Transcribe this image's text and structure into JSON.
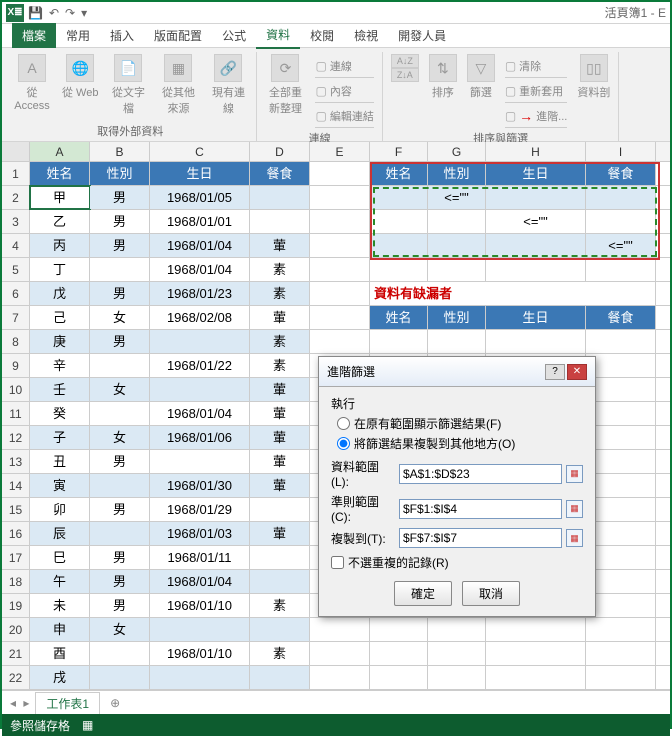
{
  "window": {
    "title": "活頁簿1 - E"
  },
  "tabs": {
    "file": "檔案",
    "home": "常用",
    "insert": "插入",
    "layout": "版面配置",
    "formula": "公式",
    "data": "資料",
    "review": "校閱",
    "view": "檢視",
    "dev": "開發人員"
  },
  "ribbon": {
    "g1": {
      "label": "取得外部資料",
      "b1": "從 Access",
      "b2": "從 Web",
      "b3": "從文字檔",
      "b4": "從其他來源",
      "b5": "現有連線"
    },
    "g2": {
      "label": "連線",
      "b1": "全部重新整理",
      "i1": "連線",
      "i2": "內容",
      "i3": "編輯連結"
    },
    "g3": {
      "label": "排序與篩選",
      "b1": "排序",
      "b2": "篩選",
      "i1": "清除",
      "i2": "重新套用",
      "i3": "進階...",
      "b3": "資料剖"
    }
  },
  "cols": [
    "A",
    "B",
    "C",
    "D",
    "E",
    "F",
    "G",
    "H",
    "I"
  ],
  "headers": {
    "c1": "姓名",
    "c2": "性別",
    "c3": "生日",
    "c4": "餐食"
  },
  "rows": [
    {
      "n": "甲",
      "s": "男",
      "d": "1968/01/05",
      "f": ""
    },
    {
      "n": "乙",
      "s": "男",
      "d": "1968/01/01",
      "f": ""
    },
    {
      "n": "丙",
      "s": "男",
      "d": "1968/01/04",
      "f": "葷"
    },
    {
      "n": "丁",
      "s": "",
      "d": "1968/01/04",
      "f": "素"
    },
    {
      "n": "戊",
      "s": "男",
      "d": "1968/01/23",
      "f": "素"
    },
    {
      "n": "己",
      "s": "女",
      "d": "1968/02/08",
      "f": "葷"
    },
    {
      "n": "庚",
      "s": "男",
      "d": "",
      "f": "素"
    },
    {
      "n": "辛",
      "s": "",
      "d": "1968/01/22",
      "f": "素"
    },
    {
      "n": "壬",
      "s": "女",
      "d": "",
      "f": "葷"
    },
    {
      "n": "癸",
      "s": "",
      "d": "1968/01/04",
      "f": "葷"
    },
    {
      "n": "子",
      "s": "女",
      "d": "1968/01/06",
      "f": "葷"
    },
    {
      "n": "丑",
      "s": "男",
      "d": "",
      "f": "葷"
    },
    {
      "n": "寅",
      "s": "",
      "d": "1968/01/30",
      "f": "葷"
    },
    {
      "n": "卯",
      "s": "男",
      "d": "1968/01/29",
      "f": ""
    },
    {
      "n": "辰",
      "s": "",
      "d": "1968/01/03",
      "f": "葷"
    },
    {
      "n": "巳",
      "s": "男",
      "d": "1968/01/11",
      "f": ""
    },
    {
      "n": "午",
      "s": "男",
      "d": "1968/01/04",
      "f": ""
    },
    {
      "n": "未",
      "s": "男",
      "d": "1968/01/10",
      "f": "素"
    },
    {
      "n": "申",
      "s": "女",
      "d": "",
      "f": ""
    },
    {
      "n": "酉",
      "s": "",
      "d": "1968/01/10",
      "f": "素"
    },
    {
      "n": "戌",
      "s": "",
      "d": "",
      "f": ""
    }
  ],
  "criteria": {
    "r2g": "<=\"\"",
    "r3h": "<=\"\"",
    "r4i": "<=\"\"",
    "note": "資料有缺漏者"
  },
  "dialog": {
    "title": "進階篩選",
    "section": "執行",
    "opt1": "在原有範圍顯示篩選結果(F)",
    "opt2": "將篩選結果複製到其他地方(O)",
    "f1l": "資料範圍(L):",
    "f1v": "$A$1:$D$23",
    "f2l": "準則範圍(C):",
    "f2v": "$F$1:$I$4",
    "f3l": "複製到(T):",
    "f3v": "$F$7:$I$7",
    "chk": "不選重複的記錄(R)",
    "ok": "確定",
    "cancel": "取消"
  },
  "sheet": {
    "tab": "工作表1",
    "status": "參照儲存格"
  }
}
